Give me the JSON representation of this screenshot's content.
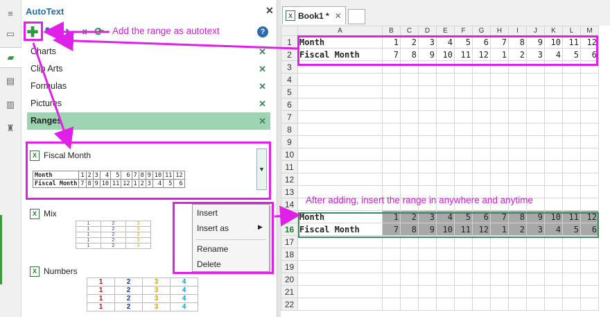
{
  "pane": {
    "title": "AutoText",
    "help": "?",
    "categories": [
      {
        "label": "Charts"
      },
      {
        "label": "Clip Arts"
      },
      {
        "label": "Formulas"
      },
      {
        "label": "Pictures"
      },
      {
        "label": "Ranges"
      }
    ],
    "entries": [
      {
        "name": "Fiscal Month"
      },
      {
        "name": "Mix"
      },
      {
        "name": "Numbers"
      }
    ],
    "preview": {
      "row1": [
        "Month",
        "1",
        "2",
        "3",
        "4",
        "5",
        "6",
        "7",
        "8",
        "9",
        "10",
        "11",
        "12"
      ],
      "row2": [
        "Fiscal Month",
        "7",
        "8",
        "9",
        "10",
        "11",
        "12",
        "1",
        "2",
        "3",
        "4",
        "5",
        "6"
      ]
    },
    "mix_rows": [
      [
        "1",
        "2",
        "3"
      ],
      [
        "1",
        "2",
        "3"
      ],
      [
        "1",
        "2",
        "3"
      ],
      [
        "1",
        "2",
        "3"
      ],
      [
        "1",
        "2",
        "3"
      ]
    ],
    "numbers_rows": [
      [
        "1",
        "2",
        "3",
        "4"
      ],
      [
        "1",
        "2",
        "3",
        "4"
      ],
      [
        "1",
        "2",
        "3",
        "4"
      ],
      [
        "1",
        "2",
        "3",
        "4"
      ]
    ]
  },
  "context_menu": {
    "insert": "Insert",
    "insert_as": "Insert as",
    "rename": "Rename",
    "delete": "Delete"
  },
  "workbook": {
    "tab_title": "Book1 *",
    "columns": [
      "A",
      "B",
      "C",
      "D",
      "E",
      "F",
      "G",
      "H",
      "I",
      "J",
      "K",
      "L",
      "M"
    ],
    "row_numbers": [
      "1",
      "2",
      "3",
      "4",
      "5",
      "6",
      "7",
      "8",
      "9",
      "10",
      "11",
      "12",
      "13",
      "14",
      "15",
      "16",
      "17",
      "18",
      "19",
      "20",
      "21",
      "22"
    ],
    "row1": [
      "Month",
      "1",
      "2",
      "3",
      "4",
      "5",
      "6",
      "7",
      "8",
      "9",
      "10",
      "11",
      "12"
    ],
    "row2": [
      "Fiscal Month",
      "7",
      "8",
      "9",
      "10",
      "11",
      "12",
      "1",
      "2",
      "3",
      "4",
      "5",
      "6"
    ]
  },
  "annotations": {
    "add_range": "Add the range as autotext",
    "after_adding": "After adding, insert the range in anywhere and anytime"
  },
  "colors": {
    "annotation": "#e020e8",
    "selected_category": "#9fd4b2",
    "number_colors": [
      "#cc1010",
      "#1a3a9a",
      "#e0a000",
      "#1a9ad0"
    ]
  }
}
